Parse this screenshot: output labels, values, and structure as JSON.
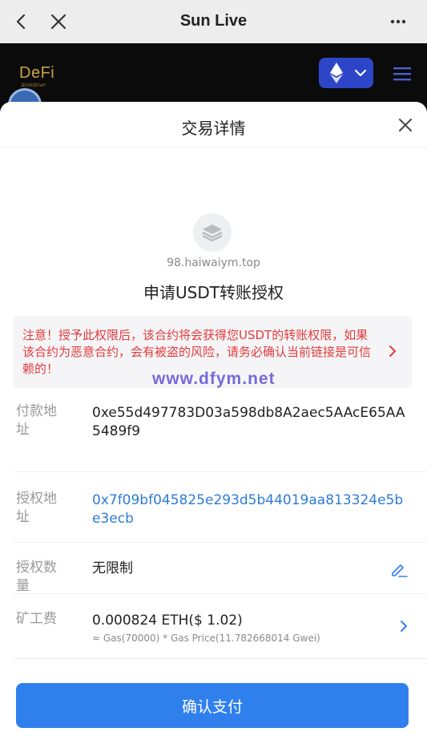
{
  "app_bar": {
    "title": "Sun Live"
  },
  "dapp": {
    "logo": "DeFi",
    "logo_sub": "深沙科技DeFi"
  },
  "sheet": {
    "title": "交易详情",
    "site": "98.haiwaiym.top",
    "heading": "申请USDT转账授权",
    "warning": "注意！授予此权限后，该合约将会获得您USDT的转账权限，如果该合约为恶意合约，会有被盗的风险，请务必确认当前链接是可信赖的！",
    "watermark": "www.dfym.net",
    "rows": [
      {
        "label": "付款地址",
        "value": "0xe55d497783D03a598db8A2aec5AAcE65AA5489f9"
      },
      {
        "label": "授权地址",
        "value": "0x7f09bf045825e293d5b44019aa813324e5be3ecb"
      },
      {
        "label": "授权数量",
        "value": "无限制"
      },
      {
        "label": "矿工费",
        "value": "0.000824 ETH($ 1.02)",
        "sub": "≈ Gas(70000) * Gas Price(11.782668014 Gwei)"
      }
    ],
    "confirm_label": "确认支付"
  },
  "colors": {
    "accent": "#2f80ed",
    "warning": "#e23b3b",
    "link": "#2d7bd8"
  }
}
